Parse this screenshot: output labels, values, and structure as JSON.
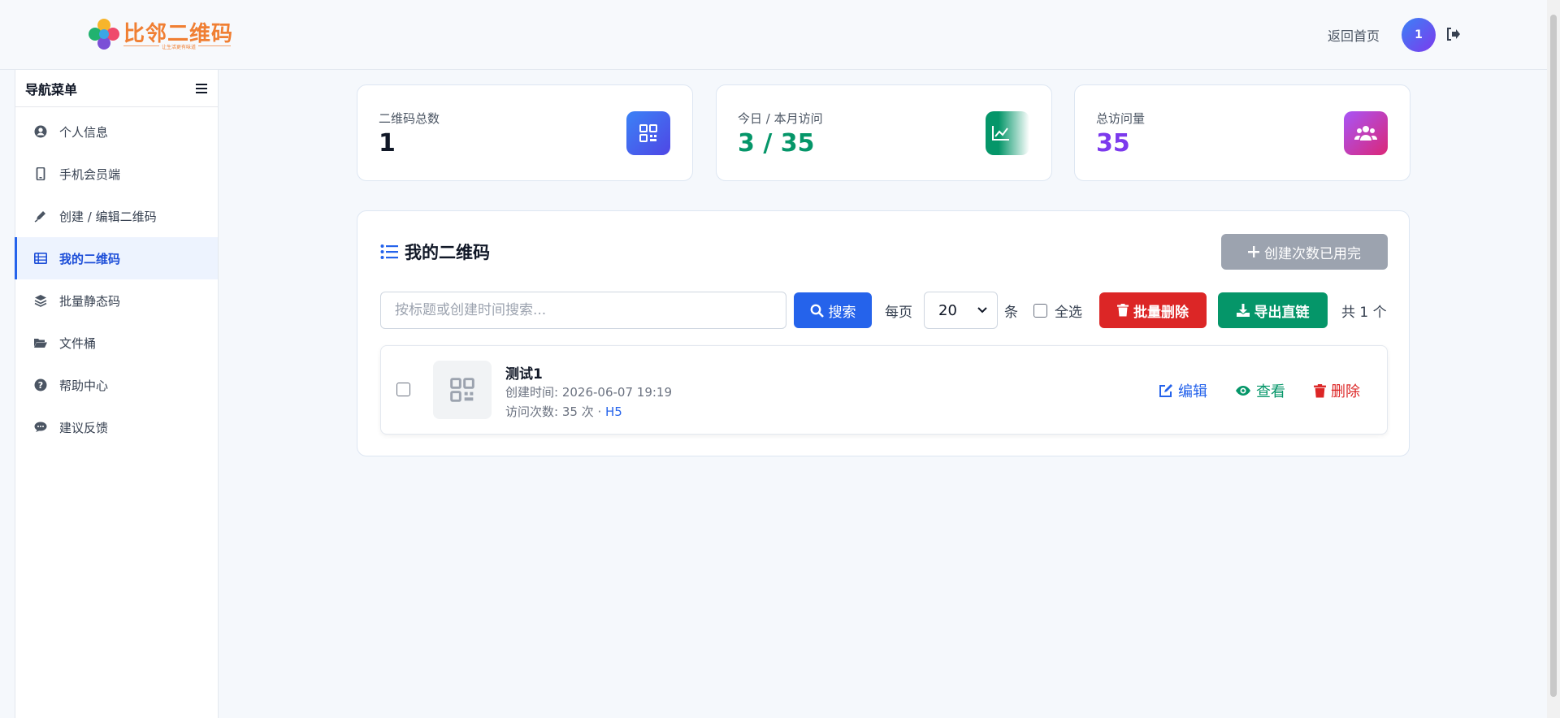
{
  "header": {
    "logo_text": "比邻二维码",
    "logo_sub": "让生活更有味道",
    "home_link": "返回首页",
    "avatar_initial": "1"
  },
  "sidebar": {
    "title": "导航菜单",
    "items": [
      {
        "label": "个人信息",
        "icon": "user-circle-icon"
      },
      {
        "label": "手机会员端",
        "icon": "mobile-icon"
      },
      {
        "label": "创建 / 编辑二维码",
        "icon": "pen-icon"
      },
      {
        "label": "我的二维码",
        "icon": "table-icon",
        "active": true
      },
      {
        "label": "批量静态码",
        "icon": "layers-icon"
      },
      {
        "label": "文件桶",
        "icon": "folder-open-icon"
      },
      {
        "label": "帮助中心",
        "icon": "question-circle-icon"
      },
      {
        "label": "建议反馈",
        "icon": "comment-icon"
      }
    ]
  },
  "stats": [
    {
      "label": "二维码总数",
      "value": "1",
      "value_color": "#111827",
      "icon": "qrcode-icon"
    },
    {
      "label": "今日 / 本月访问",
      "value": "3 / 35",
      "value_color": "#059669",
      "icon": "chart-line-icon"
    },
    {
      "label": "总访问量",
      "value": "35",
      "value_color": "#7c3aed",
      "icon": "users-icon"
    }
  ],
  "panel": {
    "title": "我的二维码",
    "create_button": "创建次数已用完",
    "search_placeholder": "按标题或创建时间搜索...",
    "search_button": "搜索",
    "per_page_label": "每页",
    "per_page_value": "20",
    "per_page_unit": "条",
    "select_all": "全选",
    "batch_delete": "批量删除",
    "export_links": "导出直链",
    "total_text": "共 1 个"
  },
  "qrcodes": [
    {
      "title": "测试1",
      "created_label": "创建时间:",
      "created": "2026-06-07 19:19",
      "visits_label": "访问次数:",
      "visits": "35 次 · ",
      "type": "H5",
      "actions": {
        "edit": "编辑",
        "view": "查看",
        "delete": "删除"
      }
    }
  ],
  "colors": {
    "primary": "#2563eb",
    "danger": "#dc2626",
    "success": "#059669",
    "purple": "#7c3aed",
    "disabled": "#9ca3af"
  }
}
